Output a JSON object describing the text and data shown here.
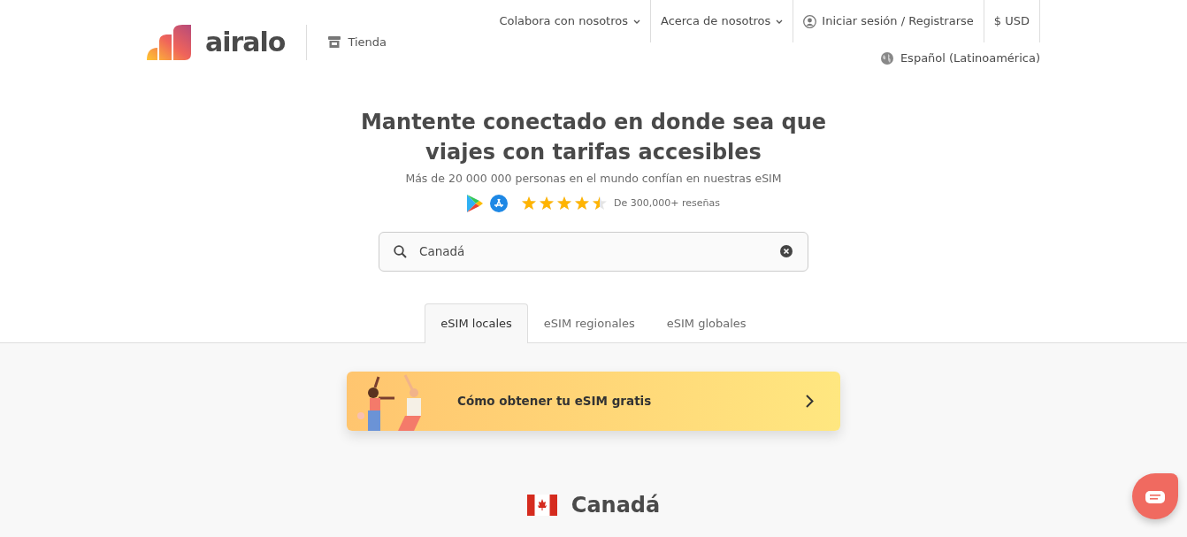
{
  "header": {
    "logo": "airalo",
    "store_link": "Tienda",
    "nav": [
      {
        "label": "Colabora con nosotros",
        "kind": "dropdown"
      },
      {
        "label": "Acerca de nosotros",
        "kind": "dropdown"
      },
      {
        "label": "Iniciar sesión / Registrarse",
        "kind": "account"
      },
      {
        "label": "$ USD",
        "kind": "plain"
      }
    ],
    "language": "Español (Latinoamérica)"
  },
  "hero": {
    "title": "Mantente conectado en donde sea que viajes con tarifas accesibles",
    "subtitle": "Más de 20 000 000 personas en el mundo confían en nuestras eSIM",
    "stars": 4.5,
    "reviews": "De 300,000+ reseñas"
  },
  "search": {
    "value": "Canadá"
  },
  "tabs": [
    {
      "label": "eSIM locales",
      "selected": true
    },
    {
      "label": "eSIM regionales",
      "selected": false
    },
    {
      "label": "eSIM globales",
      "selected": false
    }
  ],
  "banner": {
    "text": "Cómo obtener tu eSIM gratis"
  },
  "country": {
    "name": "Canadá"
  }
}
